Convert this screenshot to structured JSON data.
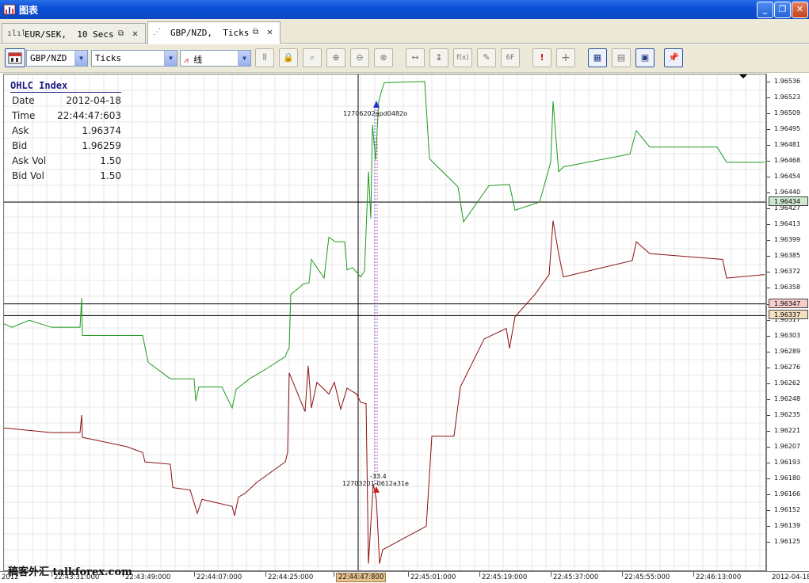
{
  "window": {
    "title": "图表",
    "minimize": "_",
    "restore": "❐",
    "close": "✕"
  },
  "tabs": [
    {
      "label": "EUR/SEK,  10 Secs",
      "glyph": "ılıl",
      "active": false
    },
    {
      "label": "GBP/NZD,  Ticks",
      "glyph": "⋰",
      "active": true
    }
  ],
  "toolbar": {
    "instrument": "GBP/NZD",
    "period": "Ticks",
    "chart_type_glyph": "⩘",
    "chart_type": "线",
    "buttons": [
      {
        "name": "indicator",
        "glyph": "⫴"
      },
      {
        "name": "lock",
        "glyph": "🔒"
      },
      {
        "name": "zoom",
        "glyph": "⌕"
      },
      {
        "name": "zoom-in",
        "glyph": "⊕"
      },
      {
        "name": "zoom-out",
        "glyph": "⊖"
      },
      {
        "name": "zoom-fit",
        "glyph": "⊗"
      },
      {
        "name": "shift",
        "glyph": "↔"
      },
      {
        "name": "auto-scale",
        "glyph": "↨"
      },
      {
        "name": "formula",
        "glyph": "f(x)"
      },
      {
        "name": "drawing",
        "glyph": "✎"
      },
      {
        "name": "fibonacci",
        "glyph": "6F"
      },
      {
        "name": "alert",
        "glyph": "!"
      },
      {
        "name": "crosshair",
        "glyph": "+"
      },
      {
        "name": "grid",
        "glyph": "▦"
      },
      {
        "name": "save",
        "glyph": "▤"
      },
      {
        "name": "template",
        "glyph": "▣"
      },
      {
        "name": "pin",
        "glyph": "📌"
      }
    ]
  },
  "ohlc": {
    "title": "OHLC Index",
    "rows": [
      {
        "k": "Date",
        "v": "2012-04-18"
      },
      {
        "k": "Time",
        "v": "22:44:47:603"
      },
      {
        "k": "Ask",
        "v": "1.96374"
      },
      {
        "k": "Bid",
        "v": "1.96259"
      },
      {
        "k": "Ask Vol",
        "v": "1.50"
      },
      {
        "k": "Bid Vol",
        "v": "1.50"
      }
    ]
  },
  "orders": {
    "top_label": "12706202apd0482o",
    "bottom_label": "12703201-0612a31e",
    "bottom_value": "-33.4"
  },
  "price_axis": {
    "ticks": [
      "1.96536",
      "1.96523",
      "1.96509",
      "1.96495",
      "1.96481",
      "1.96468",
      "1.96454",
      "1.96440",
      "1.96427",
      "1.96413",
      "1.96399",
      "1.96385",
      "1.96372",
      "1.96358",
      "1.96331",
      "1.96317",
      "1.96303",
      "1.96289",
      "1.96276",
      "1.96262",
      "1.96248",
      "1.96235",
      "1.96221",
      "1.96207",
      "1.96193",
      "1.96180",
      "1.96166",
      "1.96152",
      "1.96139",
      "1.96125"
    ],
    "markers": [
      {
        "value": "1.96434",
        "color": "#cfe8cf"
      },
      {
        "value": "1.96347",
        "color": "#f6cccc"
      },
      {
        "value": "1.96337",
        "color": "#f3e0c0"
      }
    ]
  },
  "time_axis": {
    "start": "2012",
    "ticks": [
      "22:43:31:000",
      "22:43:49:000",
      "22:44:07:000",
      "22:44:25:000",
      "22:44:47:800",
      "22:45:01:000",
      "22:45:19:000",
      "22:45:37:000",
      "22:45:55:000",
      "22:46:13:000"
    ],
    "cursor_index": 4,
    "end": "2012-04-18"
  },
  "watermark": "稿客外汇 talkforex.com",
  "chart_data": {
    "type": "line",
    "x_unit": "time",
    "ylim": [
      1.96118,
      1.96543
    ],
    "series": [
      {
        "name": "Ask",
        "color": "#1f9a1f",
        "points": [
          [
            0,
            1.9633
          ],
          [
            10,
            1.96327
          ],
          [
            32,
            1.96333
          ],
          [
            60,
            1.96327
          ],
          [
            96,
            1.96327
          ],
          [
            98,
            1.96352
          ],
          [
            99,
            1.9632
          ],
          [
            110,
            1.9632
          ],
          [
            175,
            1.9632
          ],
          [
            182,
            1.96297
          ],
          [
            210,
            1.96283
          ],
          [
            240,
            1.96283
          ],
          [
            242,
            1.96264
          ],
          [
            246,
            1.96276
          ],
          [
            275,
            1.96276
          ],
          [
            288,
            1.96258
          ],
          [
            293,
            1.96274
          ],
          [
            310,
            1.96283
          ],
          [
            330,
            1.96291
          ],
          [
            355,
            1.96302
          ],
          [
            360,
            1.9631
          ],
          [
            362,
            1.96355
          ],
          [
            378,
            1.96364
          ],
          [
            385,
            1.96365
          ],
          [
            388,
            1.96385
          ],
          [
            404,
            1.96369
          ],
          [
            410,
            1.96404
          ],
          [
            418,
            1.964
          ],
          [
            430,
            1.964
          ],
          [
            433,
            1.96376
          ],
          [
            440,
            1.96378
          ],
          [
            450,
            1.9637
          ],
          [
            455,
            1.96375
          ],
          [
            460,
            1.9646
          ],
          [
            463,
            1.9642
          ],
          [
            465,
            1.965
          ],
          [
            469,
            1.9647
          ],
          [
            473,
            1.9652
          ],
          [
            477,
            1.9653
          ],
          [
            480,
            1.96536
          ],
          [
            531,
            1.96537
          ],
          [
            537,
            1.96471
          ],
          [
            573,
            1.96447
          ],
          [
            580,
            1.96417
          ],
          [
            612,
            1.96448
          ],
          [
            638,
            1.96449
          ],
          [
            645,
            1.96427
          ],
          [
            676,
            1.96434
          ],
          [
            690,
            1.96468
          ],
          [
            693,
            1.9652
          ],
          [
            700,
            1.9646
          ],
          [
            706,
            1.96464
          ],
          [
            790,
            1.96475
          ],
          [
            798,
            1.96495
          ],
          [
            815,
            1.96481
          ],
          [
            900,
            1.96481
          ],
          [
            912,
            1.96468
          ],
          [
            960,
            1.96468
          ]
        ]
      },
      {
        "name": "Bid",
        "color": "#8b0f0f",
        "points": [
          [
            0,
            1.96241
          ],
          [
            60,
            1.96237
          ],
          [
            96,
            1.96237
          ],
          [
            98,
            1.96252
          ],
          [
            99,
            1.96233
          ],
          [
            155,
            1.96225
          ],
          [
            175,
            1.9622
          ],
          [
            178,
            1.96212
          ],
          [
            210,
            1.9621
          ],
          [
            213,
            1.9619
          ],
          [
            235,
            1.96188
          ],
          [
            244,
            1.96168
          ],
          [
            250,
            1.9618
          ],
          [
            288,
            1.96174
          ],
          [
            291,
            1.96166
          ],
          [
            296,
            1.96182
          ],
          [
            304,
            1.96185
          ],
          [
            320,
            1.96195
          ],
          [
            355,
            1.96212
          ],
          [
            358,
            1.9622
          ],
          [
            360,
            1.96288
          ],
          [
            380,
            1.96255
          ],
          [
            384,
            1.96294
          ],
          [
            388,
            1.96258
          ],
          [
            395,
            1.9628
          ],
          [
            410,
            1.9627
          ],
          [
            417,
            1.9628
          ],
          [
            425,
            1.96257
          ],
          [
            433,
            1.96275
          ],
          [
            445,
            1.9627
          ],
          [
            450,
            1.96263
          ],
          [
            455,
            1.96262
          ],
          [
            457,
            1.96262
          ],
          [
            460,
            1.96125
          ],
          [
            466,
            1.96193
          ],
          [
            470,
            1.9618
          ],
          [
            474,
            1.96125
          ],
          [
            478,
            1.96137
          ],
          [
            533,
            1.96157
          ],
          [
            540,
            1.96234
          ],
          [
            568,
            1.96234
          ],
          [
            576,
            1.96276
          ],
          [
            606,
            1.96317
          ],
          [
            634,
            1.96326
          ],
          [
            638,
            1.96309
          ],
          [
            645,
            1.96336
          ],
          [
            670,
            1.96355
          ],
          [
            688,
            1.96372
          ],
          [
            693,
            1.96418
          ],
          [
            700,
            1.9639
          ],
          [
            706,
            1.9637
          ],
          [
            793,
            1.96384
          ],
          [
            798,
            1.964
          ],
          [
            815,
            1.9639
          ],
          [
            907,
            1.96385
          ],
          [
            912,
            1.96369
          ],
          [
            960,
            1.96372
          ]
        ]
      }
    ],
    "horizontal_lines": [
      1.96434,
      1.96347,
      1.96337
    ],
    "crosshair_x_label": "22:44:47:800",
    "crosshair_y": 1.96434
  }
}
